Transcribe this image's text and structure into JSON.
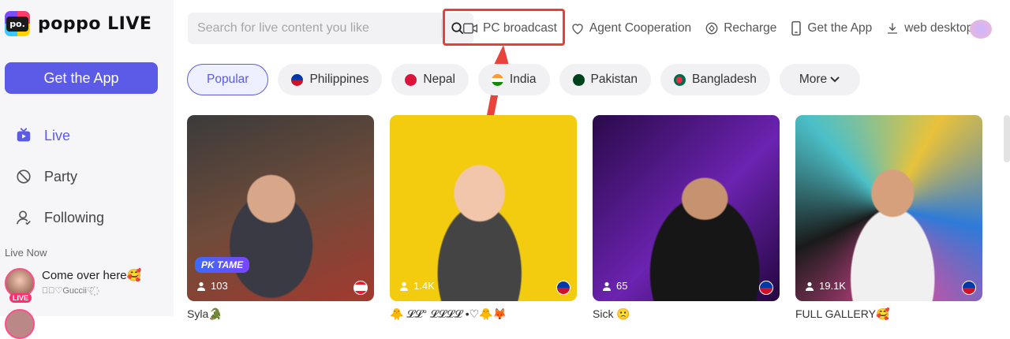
{
  "brand": {
    "logo_mark": "po.",
    "name": "poppo LIVE"
  },
  "sidebar": {
    "get_app": "Get the App",
    "nav": [
      {
        "label": "Live",
        "icon": "tv-icon",
        "active": true
      },
      {
        "label": "Party",
        "icon": "party-icon",
        "active": false
      },
      {
        "label": "Following",
        "icon": "person-icon",
        "active": false
      }
    ],
    "live_now_label": "Live Now",
    "live_items": [
      {
        "title": "Come over here🥰",
        "subtitle": "꙰⃟♡Guccii♡꙰",
        "badge": "LIVE"
      }
    ]
  },
  "search": {
    "placeholder": "Search for live content you like"
  },
  "top_links": [
    {
      "label": "PC broadcast",
      "icon": "video-camera-icon"
    },
    {
      "label": "Agent Cooperation",
      "icon": "handshake-icon"
    },
    {
      "label": "Recharge",
      "icon": "coin-icon"
    },
    {
      "label": "Get the App",
      "icon": "phone-icon"
    },
    {
      "label": "web desktop",
      "icon": "download-icon"
    }
  ],
  "chips": [
    {
      "label": "Popular",
      "active": true,
      "flag_color": ""
    },
    {
      "label": "Philippines",
      "active": false,
      "flag_color": "#0038a8"
    },
    {
      "label": "Nepal",
      "active": false,
      "flag_color": "#dc143c"
    },
    {
      "label": "India",
      "active": false,
      "flag_color": "#ff9933"
    },
    {
      "label": "Pakistan",
      "active": false,
      "flag_color": "#01411c"
    },
    {
      "label": "Bangladesh",
      "active": false,
      "flag_color": "#006a4e"
    }
  ],
  "more_label": "More",
  "cards": [
    {
      "viewers": "103",
      "name": "Syla🐊 ",
      "badge": "PK TAME",
      "flag": "lebanon"
    },
    {
      "viewers": "1.4K",
      "name": "🐥 𝓛𝓛° 𝓛𝓛𝓛𝓛 •♡🐥🦊",
      "badge": "",
      "flag": "philippines"
    },
    {
      "viewers": "65",
      "name": "Sick 🙁",
      "badge": "",
      "flag": "philippines"
    },
    {
      "viewers": "19.1K",
      "name": "FULL GALLERY🥰",
      "badge": "",
      "flag": "philippines"
    }
  ],
  "colors": {
    "accent": "#5b5be8",
    "highlight": "#e5403a"
  }
}
